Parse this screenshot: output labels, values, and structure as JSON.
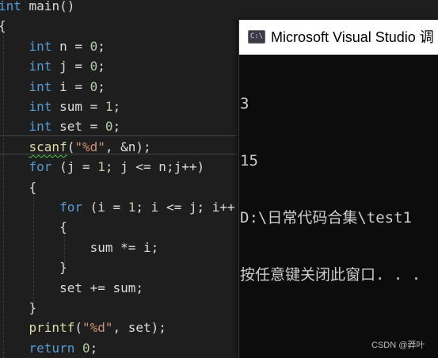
{
  "editor": {
    "lines": [
      [
        {
          "t": "int",
          "c": "kw"
        },
        {
          "t": " main()",
          "c": "plain"
        }
      ],
      [
        {
          "t": "{",
          "c": "plain"
        }
      ],
      [
        {
          "t": "    "
        },
        {
          "t": "int",
          "c": "kw"
        },
        {
          "t": " n = ",
          "c": "plain"
        },
        {
          "t": "0",
          "c": "num"
        },
        {
          "t": ";",
          "c": "plain"
        }
      ],
      [
        {
          "t": "    "
        },
        {
          "t": "int",
          "c": "kw"
        },
        {
          "t": " j = ",
          "c": "plain"
        },
        {
          "t": "0",
          "c": "num"
        },
        {
          "t": ";",
          "c": "plain"
        }
      ],
      [
        {
          "t": "    "
        },
        {
          "t": "int",
          "c": "kw"
        },
        {
          "t": " i = ",
          "c": "plain"
        },
        {
          "t": "0",
          "c": "num"
        },
        {
          "t": ";",
          "c": "plain"
        }
      ],
      [
        {
          "t": "    "
        },
        {
          "t": "int",
          "c": "kw"
        },
        {
          "t": " sum = ",
          "c": "plain"
        },
        {
          "t": "1",
          "c": "num"
        },
        {
          "t": ";",
          "c": "plain"
        }
      ],
      [
        {
          "t": "    "
        },
        {
          "t": "int",
          "c": "kw"
        },
        {
          "t": " set = ",
          "c": "plain"
        },
        {
          "t": "0",
          "c": "num"
        },
        {
          "t": ";",
          "c": "plain"
        }
      ],
      [
        {
          "t": "    "
        },
        {
          "t": "scanf",
          "c": "fn squiggle"
        },
        {
          "t": "(",
          "c": "plain"
        },
        {
          "t": "\"%d\"",
          "c": "str"
        },
        {
          "t": ", &n);",
          "c": "plain"
        }
      ],
      [
        {
          "t": "    "
        },
        {
          "t": "for",
          "c": "kw"
        },
        {
          "t": " (j = ",
          "c": "plain"
        },
        {
          "t": "1",
          "c": "num"
        },
        {
          "t": "; j <= n;j++)",
          "c": "plain"
        }
      ],
      [
        {
          "t": "    "
        },
        {
          "t": "{",
          "c": "plain"
        }
      ],
      [
        {
          "t": "        "
        },
        {
          "t": "for",
          "c": "kw"
        },
        {
          "t": " (i = ",
          "c": "plain"
        },
        {
          "t": "1",
          "c": "num"
        },
        {
          "t": "; i <= j; i++",
          "c": "plain"
        }
      ],
      [
        {
          "t": "        "
        },
        {
          "t": "{",
          "c": "plain"
        }
      ],
      [
        {
          "t": "            "
        },
        {
          "t": "sum",
          "c": "plain"
        },
        {
          "t": " *= i;",
          "c": "plain"
        }
      ],
      [
        {
          "t": "        "
        },
        {
          "t": "}",
          "c": "plain"
        }
      ],
      [
        {
          "t": "        "
        },
        {
          "t": "set",
          "c": "plain"
        },
        {
          "t": " += sum;",
          "c": "plain"
        }
      ],
      [
        {
          "t": "    "
        },
        {
          "t": "}",
          "c": "plain"
        }
      ],
      [
        {
          "t": "    "
        },
        {
          "t": "printf",
          "c": "fn"
        },
        {
          "t": "(",
          "c": "plain"
        },
        {
          "t": "\"%d\"",
          "c": "str"
        },
        {
          "t": ", set);",
          "c": "plain"
        }
      ],
      [
        {
          "t": "    "
        },
        {
          "t": "return",
          "c": "kw"
        },
        {
          "t": " ",
          "c": "plain"
        },
        {
          "t": "0",
          "c": "num"
        },
        {
          "t": ";",
          "c": "plain"
        }
      ]
    ]
  },
  "console": {
    "icon_text": "C:\\",
    "icon": "console-app-icon",
    "title": "Microsoft Visual Studio 调",
    "output_lines": [
      "3",
      "15",
      "D:\\日常代码合集\\test1",
      "按任意键关闭此窗口. . ."
    ]
  },
  "watermark": "CSDN @莽叶",
  "colors": {
    "editor_bg": "#1e1e1e",
    "keyword": "#569cd6",
    "function": "#dcdcaa",
    "number": "#b5cea8",
    "string": "#ce9178",
    "console_bg": "#0c0c0c",
    "console_text": "#cccccc",
    "squiggle": "#4ec94e"
  }
}
